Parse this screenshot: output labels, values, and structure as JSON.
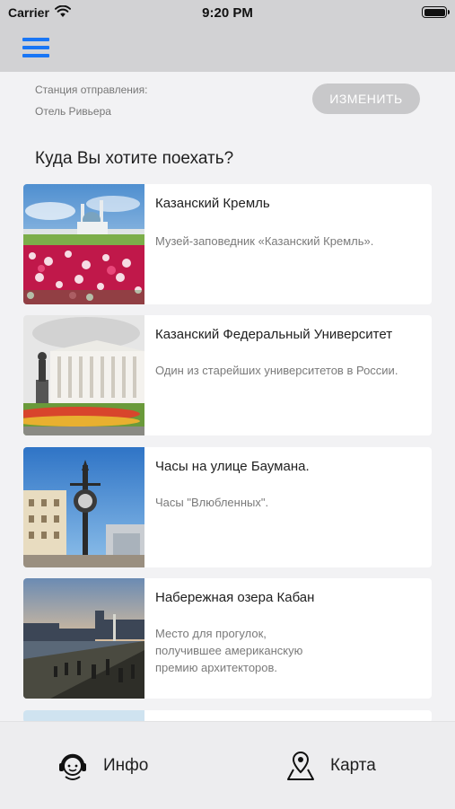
{
  "status_bar": {
    "carrier": "Carrier",
    "time": "9:20 PM",
    "icons": [
      "wifi-icon",
      "battery-icon"
    ]
  },
  "nav": {
    "menu_icon": "hamburger-menu-icon",
    "accent_color": "#1976f5"
  },
  "departure": {
    "label": "Станция отправления:",
    "value": "Отель Ривьера",
    "change_button": "ИЗМЕНИТЬ"
  },
  "section_title": "Куда Вы хотите поехать?",
  "destinations": [
    {
      "title": "Казанский Кремль",
      "description": "Музей-заповедник «Казанский Кремль».",
      "image": "kremlin-photo"
    },
    {
      "title": "Казанский Федеральный Университет",
      "description": "Один из старейших университетов в России.",
      "image": "university-photo"
    },
    {
      "title": "Часы на улице Баумана.",
      "description": "Часы \"Влюбленных\".",
      "image": "clock-photo"
    },
    {
      "title": "Набережная озера Кабан",
      "description": "Место для прогулок,\nполучившее американскую\nпремию архитекторов.",
      "image": "embankment-photo"
    }
  ],
  "tab_bar": {
    "info_label": "Инфо",
    "info_icon": "headset-support-icon",
    "map_label": "Карта",
    "map_icon": "map-pin-icon"
  }
}
